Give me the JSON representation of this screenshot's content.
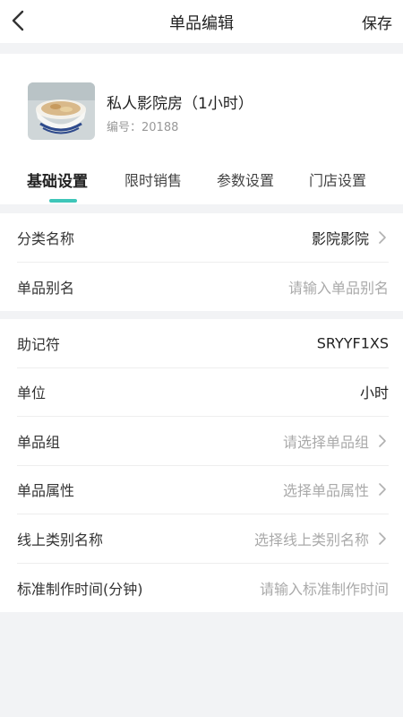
{
  "header": {
    "title": "单品编辑",
    "save_label": "保存"
  },
  "product": {
    "name": "私人影院房（1小时）",
    "code": "编号：20188"
  },
  "tabs": [
    {
      "label": "基础设置",
      "active": true
    },
    {
      "label": "限时销售",
      "active": false
    },
    {
      "label": "参数设置",
      "active": false
    },
    {
      "label": "门店设置",
      "active": false
    }
  ],
  "group1": [
    {
      "label": "分类名称",
      "value": "影院影院"
    },
    {
      "label": "单品别名",
      "placeholder": "请输入单品别名"
    }
  ],
  "group2": [
    {
      "label": "助记符",
      "value": "SRYYF1XS"
    },
    {
      "label": "单位",
      "value": "小时"
    },
    {
      "label": "单品组",
      "placeholder": "请选择单品组"
    },
    {
      "label": "单品属性",
      "placeholder": "选择单品属性"
    },
    {
      "label": "线上类别名称",
      "placeholder": "选择线上类别名称"
    },
    {
      "label": "标准制作时间(分钟)",
      "placeholder": "请输入标准制作时间"
    }
  ],
  "colors": {
    "accent": "#3ec6b9",
    "background": "#f2f3f5"
  },
  "icons": {
    "back": "chevron-left-icon",
    "row_arrow": "chevron-right-icon"
  }
}
